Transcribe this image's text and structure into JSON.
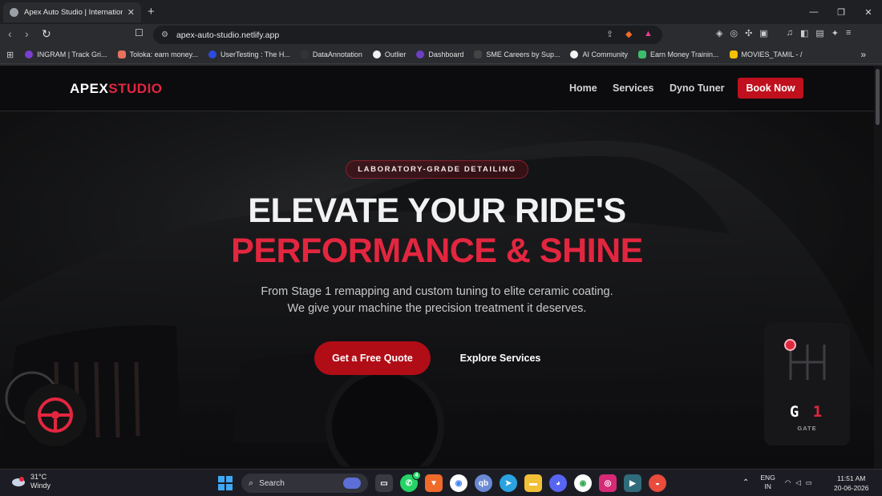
{
  "browser": {
    "tab_title": "Apex Auto Studio | International",
    "url": "apex-auto-studio.netlify.app",
    "bookmarks": [
      {
        "label": "INGRAM | Track Gri...",
        "color": "#7a3fd0"
      },
      {
        "label": "Toloka: earn money...",
        "color": "#e8725c"
      },
      {
        "label": "UserTesting : The H...",
        "color": "#2c4be0"
      },
      {
        "label": "DataAnnotation",
        "color": "#333333"
      },
      {
        "label": "Outlier",
        "color": "#f2f2f2"
      },
      {
        "label": "Dashboard",
        "color": "#6d3fc4"
      },
      {
        "label": "SME Careers by Sup...",
        "color": "#444444"
      },
      {
        "label": "AI Community",
        "color": "#f2f2f2"
      },
      {
        "label": "Earn Money Trainin...",
        "color": "#3bbf6a"
      },
      {
        "label": "MOVIES_TAMIL - /",
        "color": "#f5c000"
      }
    ]
  },
  "site": {
    "logo_part1": "APEX",
    "logo_part2": "STUDIO",
    "nav": {
      "home": "Home",
      "services": "Services",
      "dyno": "Dyno Tuner",
      "book": "Book Now"
    },
    "hero": {
      "badge": "LABORATORY-GRADE DETAILING",
      "title_line1": "ELEVATE YOUR RIDE'S",
      "title_line2": "PERFORMANCE & SHINE",
      "subtitle_line1": "From Stage 1 remapping and custom tuning to elite ceramic coating.",
      "subtitle_line2": "We give your machine the precision treatment it deserves.",
      "cta_primary": "Get a Free Quote",
      "cta_secondary": "Explore Services"
    },
    "gear_widget": {
      "gear_letter": "G",
      "gear_number": "1",
      "label": "GATE"
    },
    "colors": {
      "accent": "#e3263f",
      "button": "#c0101d"
    }
  },
  "taskbar": {
    "temperature": "31°C",
    "condition": "Windy",
    "search_label": "Search",
    "lang1": "ENG",
    "lang2": "IN",
    "time": "11:51 AM",
    "date": "20-06-2026",
    "whatsapp_badge": "4"
  }
}
